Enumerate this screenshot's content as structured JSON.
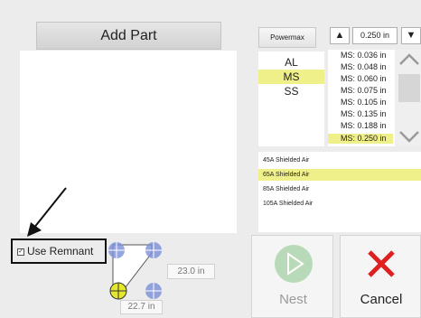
{
  "add_part_label": "Add Part",
  "sync_label": "Powermax SYNC",
  "thickness": {
    "current": "0.250 in",
    "up_glyph": "▲",
    "down_glyph": "▼"
  },
  "materials": [
    {
      "label": "AL",
      "selected": false
    },
    {
      "label": "MS",
      "selected": true
    },
    {
      "label": "SS",
      "selected": false
    }
  ],
  "thickness_list": [
    {
      "label": "MS: 0.036 in",
      "selected": false
    },
    {
      "label": "MS: 0.048 in",
      "selected": false
    },
    {
      "label": "MS: 0.060 in",
      "selected": false
    },
    {
      "label": "MS: 0.075 in",
      "selected": false
    },
    {
      "label": "MS: 0.105 in",
      "selected": false
    },
    {
      "label": "MS: 0.135 in",
      "selected": false
    },
    {
      "label": "MS: 0.188 in",
      "selected": false
    },
    {
      "label": "MS: 0.250 in",
      "selected": true
    }
  ],
  "processes": [
    {
      "label": "45A Shielded Air",
      "selected": false
    },
    {
      "label": "65A Shielded Air",
      "selected": true
    },
    {
      "label": "85A Shielded Air",
      "selected": false
    },
    {
      "label": "105A Shielded Air",
      "selected": false
    }
  ],
  "remnant": {
    "label": "Use Remnant",
    "checked": true
  },
  "remnant_dims": {
    "width": "23.0 in",
    "height": "22.7 in"
  },
  "nest_label": "Nest",
  "cancel_label": "Cancel",
  "colors": {
    "highlight": "#f0f08a",
    "origin_marker": "#e6e62e",
    "corner_marker": "#7a8fd8",
    "cancel_x": "#e02020",
    "nest_icon": "#b9dab9"
  }
}
